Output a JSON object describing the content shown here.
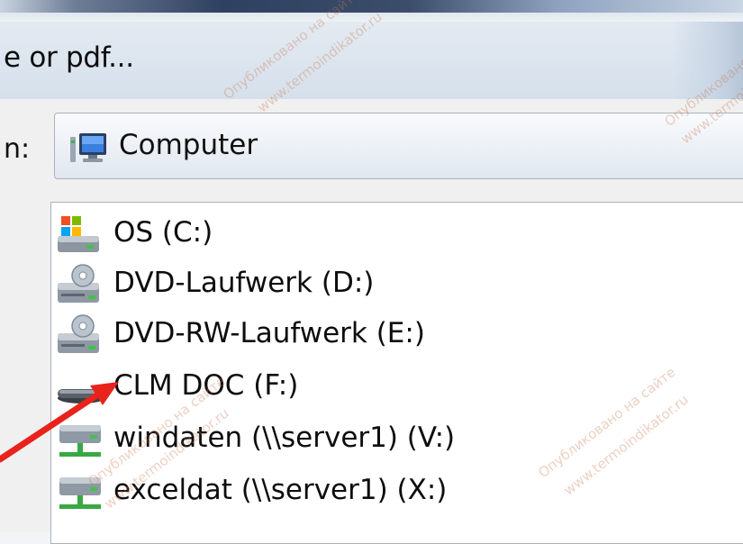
{
  "window": {
    "title_partial": "e or pdf..."
  },
  "look_in": {
    "label_partial": "n:",
    "value": "Computer",
    "icon": "computer-icon"
  },
  "drives": [
    {
      "label": "OS (C:)",
      "icon": "windows-drive-icon"
    },
    {
      "label": "DVD-Laufwerk (D:)",
      "icon": "dvd-drive-icon"
    },
    {
      "label": "DVD-RW-Laufwerk (E:)",
      "icon": "dvd-drive-icon"
    },
    {
      "label": "CLM DOC (F:)",
      "icon": "removable-drive-icon"
    },
    {
      "label": "windaten (\\\\server1) (V:)",
      "icon": "network-drive-icon"
    },
    {
      "label": "exceldat (\\\\server1) (X:)",
      "icon": "network-drive-icon"
    }
  ],
  "annotation": {
    "arrow_color": "#e8231c"
  },
  "watermark": {
    "text_ru": "Опубликовано на сайте",
    "text_url": "www.termoindikator.ru"
  }
}
